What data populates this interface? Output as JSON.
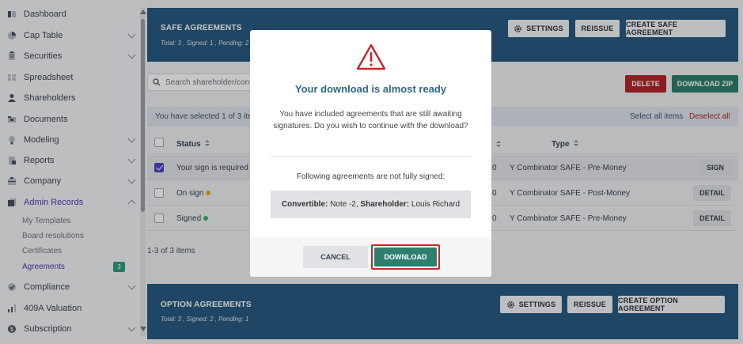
{
  "sidebar": {
    "items": [
      {
        "label": "Dashboard",
        "icon": "dashboard-icon"
      },
      {
        "label": "Cap Table",
        "icon": "pie-chart-icon"
      },
      {
        "label": "Securities",
        "icon": "clipboard-icon"
      },
      {
        "label": "Spreadsheet",
        "icon": "spreadsheet-icon"
      },
      {
        "label": "Shareholders",
        "icon": "user-icon"
      },
      {
        "label": "Documents",
        "icon": "folder-icon"
      },
      {
        "label": "Modeling",
        "icon": "lightbulb-icon"
      },
      {
        "label": "Reports",
        "icon": "report-icon"
      },
      {
        "label": "Company",
        "icon": "briefcase-icon"
      },
      {
        "label": "Admin Records",
        "icon": "records-icon"
      },
      {
        "label": "Compliance",
        "icon": "check-shield-icon"
      },
      {
        "label": "409A Valuation",
        "icon": "valuation-icon"
      },
      {
        "label": "Subscription",
        "icon": "dollar-icon"
      }
    ],
    "sub_items": [
      {
        "label": "My Templates"
      },
      {
        "label": "Board resolutions"
      },
      {
        "label": "Certificates"
      },
      {
        "label": "Agreements",
        "badge": "3"
      }
    ]
  },
  "safe": {
    "title": "SAFE AGREEMENTS",
    "summary": "Total: 3 , Signed: 1 , Pending: 2",
    "settings_label": "SETTINGS",
    "reissue_label": "REISSUE",
    "create_label": "CREATE SAFE AGREEMENT"
  },
  "toolbar": {
    "search_placeholder": "Search shareholder/conv",
    "delete_label": "DELETE",
    "download_zip_label": "DOWNLOAD ZIP"
  },
  "selection": {
    "text": "You have selected 1 of 3 item",
    "select_all": "Select all items",
    "deselect_all": "Deselect all"
  },
  "table": {
    "columns": {
      "status": "Status",
      "type": "Type"
    },
    "rows": [
      {
        "status": "Your sign is required",
        "dot": "#e9a825",
        "amount": "0",
        "type": "Y Combinator SAFE - Pre-Money",
        "action": "SIGN",
        "checked": true
      },
      {
        "status": "On sign",
        "dot": "#e9a825",
        "amount": "0",
        "type": "Y Combinator SAFE - Post-Money",
        "action": "DETAIL",
        "checked": false
      },
      {
        "status": "Signed",
        "dot": "#3bb273",
        "amount": "0",
        "type": "Y Combinator SAFE - Pre-Money",
        "action": "DETAIL",
        "checked": false
      }
    ],
    "items_count": "1-3 of 3 items"
  },
  "option": {
    "title": "OPTION AGREEMENTS",
    "summary": "Total: 3 , Signed: 2 , Pending: 1",
    "settings_label": "SETTINGS",
    "reissue_label": "REISSUE",
    "create_label": "CREATE OPTION AGREEMENT"
  },
  "modal": {
    "title": "Your download is almost ready",
    "message": "You have included agreements that are still awaiting signatures. Do you wish to continue with the download?",
    "following": "Following agreements are not fully signed:",
    "convertible_label": "Convertible:",
    "convertible_value": "Note -2,",
    "shareholder_label": "Shareholder:",
    "shareholder_value": "Louis Richard",
    "cancel_label": "CANCEL",
    "download_label": "DOWNLOAD"
  },
  "colors": {
    "header_blue": "#285a80",
    "accent_purple": "#4a3fb0",
    "download_green": "#2e7f6e",
    "danger_red": "#b3262b",
    "warning_red": "#c9262b"
  }
}
